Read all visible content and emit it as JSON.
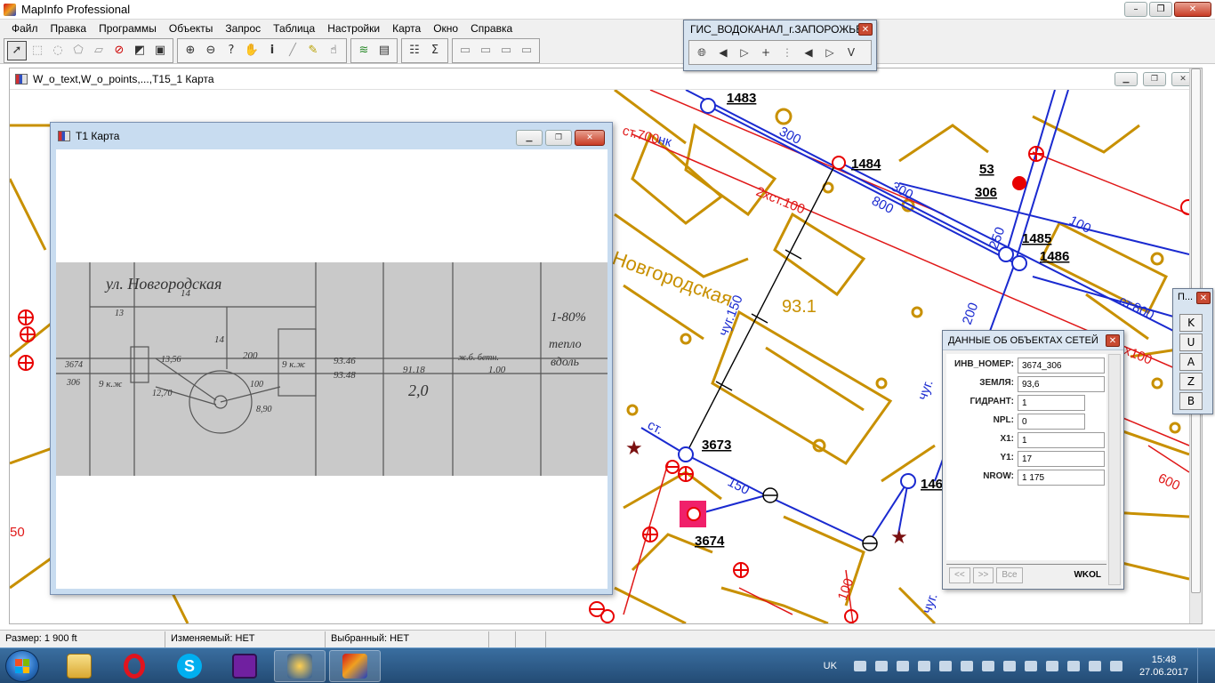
{
  "app": {
    "title": "MapInfo Professional",
    "window_buttons": [
      "–",
      "❐",
      "✕"
    ]
  },
  "menu": [
    "Файл",
    "Правка",
    "Программы",
    "Объекты",
    "Запрос",
    "Таблица",
    "Настройки",
    "Карта",
    "Окно",
    "Справка"
  ],
  "toolbar": {
    "groups": [
      [
        "select-arrow",
        "marquee-select",
        "radius-select",
        "polygon-select",
        "boundary-select",
        "unselect",
        "graphic-select",
        "inverse-select"
      ],
      [
        "zoom-in",
        "zoom-out",
        "change-view",
        "grabber",
        "info",
        "ruler",
        "label",
        "hotlink"
      ],
      [
        "layer-control",
        "legend"
      ],
      [
        "new-browser",
        "sum"
      ],
      [
        "redistrict-a",
        "redistrict-b",
        "redistrict-c",
        "redistrict-d"
      ]
    ]
  },
  "gis_panel": {
    "title": "ГИС_ВОДОКАНАЛ_г.ЗАПОРОЖЬЕ",
    "close": "✕",
    "tools": [
      "globe",
      "arrow-left",
      "arrow-right-outline",
      "plus",
      "tree",
      "arrow-left-2",
      "arrow-right-2",
      "check-v"
    ]
  },
  "map_window": {
    "title": "W_o_text,W_o_points,...,T15_1 Карта",
    "labels": {
      "n1483": "1483",
      "n1484": "1484",
      "n1485": "1485",
      "n1486": "1486",
      "n3673": "3673",
      "n3674": "3674",
      "n146": "146",
      "n53": "53",
      "n306": "306",
      "p300a": "300",
      "p300b": "300",
      "p800": "800",
      "p250": "250",
      "p100": "100",
      "p200": "200",
      "p150": "150",
      "pst800": "ст.800",
      "pchug150": "чуг.150",
      "p2xst100": "2хст.100",
      "pst700": "ст.700",
      "street": "Новгородская",
      "elev": "93.1",
      "pnk": "нк",
      "p600": "600",
      "p150b": "150",
      "p50": "50",
      "p100b": "100",
      "pchug": "чуг.",
      "pst": "ст.",
      "rx100": "р.х100",
      "pchug2": "чуг."
    }
  },
  "t1_window": {
    "title": "T1 Карта",
    "photo_text": {
      "street": "ул. Новгородская",
      "n14": "14",
      "n13": "13",
      "n3674": "3674",
      "n306": "306",
      "n9kzh": "9 к.ж",
      "n9kzh2": "9 к.ж",
      "d1356": "13,56",
      "d1270": "12,70",
      "d200": "200",
      "d100": "100",
      "d890": "8,90",
      "d14v": "14",
      "e9348": "93.48",
      "e9346": "93.46",
      "e9118": "91.18",
      "d20": "2,0",
      "zhb": "ж.б. бетн.",
      "d100b": "1.00",
      "pct": "1-80%",
      "teplo": "тепло",
      "vodn": "вдоль"
    }
  },
  "data_panel": {
    "title": "ДАННЫЕ ОБ ОБЪЕКТАХ СЕТЕЙ",
    "close": "✕",
    "fields": [
      {
        "label": "ИНВ_НОМЕР:",
        "value": "3674_306"
      },
      {
        "label": "ЗЕМЛЯ:",
        "value": "93,6"
      },
      {
        "label": "ГИДРАНТ:",
        "value": "1"
      },
      {
        "label": "NPL:",
        "value": "0"
      },
      {
        "label": "X1:",
        "value": "1"
      },
      {
        "label": "Y1:",
        "value": "17"
      },
      {
        "label": "NROW:",
        "value": "1 175"
      }
    ],
    "nav": {
      "prev": "<<",
      "next": ">>",
      "all": "Все"
    },
    "layer": "WKOL"
  },
  "p_panel": {
    "title": "П...",
    "close": "✕",
    "buttons": [
      "K",
      "U",
      "A",
      "Z",
      "B"
    ]
  },
  "status": {
    "size": "Размер: 1 900 ft",
    "editable": "Изменяемый: НЕТ",
    "selected": "Выбранный: НЕТ"
  },
  "taskbar": {
    "apps": [
      "explorer",
      "opera",
      "skype",
      "save-disk",
      "media-player",
      "mapinfo"
    ],
    "lang": "UK",
    "time": "15:48",
    "date": "27.06.2017"
  },
  "colors": {
    "map_base": "#c89000",
    "pipe_blue": "#1a2ad0",
    "pipe_red": "#e01818",
    "hydrant_red": "#e80000",
    "highlight_magenta": "#f0206a"
  }
}
